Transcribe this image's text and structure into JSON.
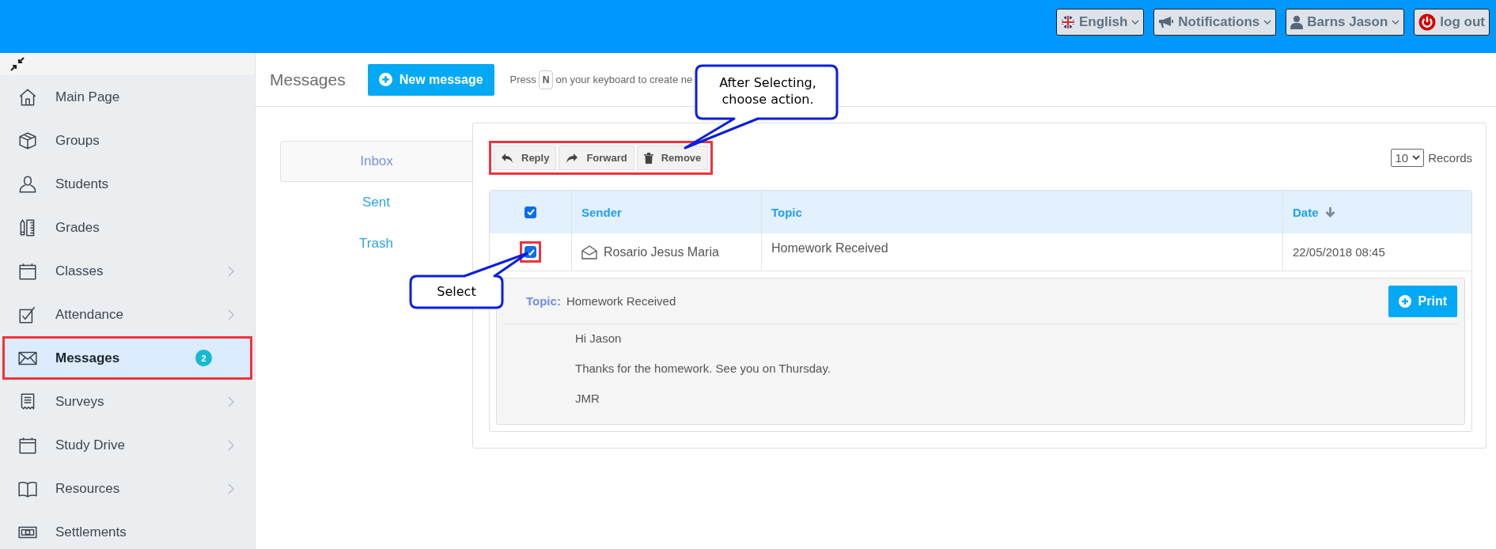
{
  "top_bar": {
    "buttons": [
      {
        "label": "English",
        "kind": "language",
        "dropdown": true
      },
      {
        "label": "Notifications",
        "kind": "notifications",
        "dropdown": true
      },
      {
        "label": "Barns Jason",
        "kind": "user",
        "dropdown": true
      },
      {
        "label": "log out",
        "kind": "logout",
        "dropdown": false
      }
    ]
  },
  "sidebar": {
    "items": [
      {
        "label": "Main Page",
        "expandable": false,
        "selected": false,
        "highlighted": false
      },
      {
        "label": "Groups",
        "expandable": false,
        "selected": false,
        "highlighted": false
      },
      {
        "label": "Students",
        "expandable": false,
        "selected": false,
        "highlighted": false
      },
      {
        "label": "Grades",
        "expandable": false,
        "selected": false,
        "highlighted": false
      },
      {
        "label": "Classes",
        "expandable": true,
        "selected": false,
        "highlighted": false
      },
      {
        "label": "Attendance",
        "expandable": true,
        "selected": false,
        "highlighted": false
      },
      {
        "label": "Messages",
        "expandable": false,
        "selected": true,
        "highlighted": true,
        "badge": "2"
      },
      {
        "label": "Surveys",
        "expandable": true,
        "selected": false,
        "highlighted": false
      },
      {
        "label": "Study Drive",
        "expandable": true,
        "selected": false,
        "highlighted": false
      },
      {
        "label": "Resources",
        "expandable": true,
        "selected": false,
        "highlighted": false
      },
      {
        "label": "Settlements",
        "expandable": false,
        "selected": false,
        "highlighted": false
      }
    ]
  },
  "header": {
    "title": "Messages",
    "new_button": "New message",
    "hint_before": "Press",
    "hint_key": "N",
    "hint_after": "on your keyboard to create ne"
  },
  "folders": [
    {
      "label": "Inbox",
      "selected": true
    },
    {
      "label": "Sent",
      "selected": false
    },
    {
      "label": "Trash",
      "selected": false
    }
  ],
  "toolbar": {
    "highlighted": true,
    "buttons": [
      {
        "label": "Reply",
        "kind": "reply"
      },
      {
        "label": "Forward",
        "kind": "forward"
      },
      {
        "label": "Remove",
        "kind": "remove"
      }
    ]
  },
  "records": {
    "value": "10",
    "label": "Records"
  },
  "table": {
    "select_all_checked": true,
    "columns": [
      "Sender",
      "Topic",
      "Date"
    ],
    "rows": [
      {
        "checked": true,
        "highlighted": true,
        "sender": "Rosario Jesus Maria",
        "topic": "Homework Received",
        "date": "22/05/2018 08:45"
      }
    ]
  },
  "detail": {
    "topic_label": "Topic:",
    "topic": "Homework Received",
    "print_button": "Print",
    "lines": [
      "Hi Jason",
      "Thanks for the homework. See you on Thursday.",
      "JMR"
    ]
  },
  "annotations": [
    {
      "text": "After Selecting, choose action.",
      "kind": "toolbar"
    },
    {
      "text": "Select",
      "kind": "checkbox"
    }
  ]
}
